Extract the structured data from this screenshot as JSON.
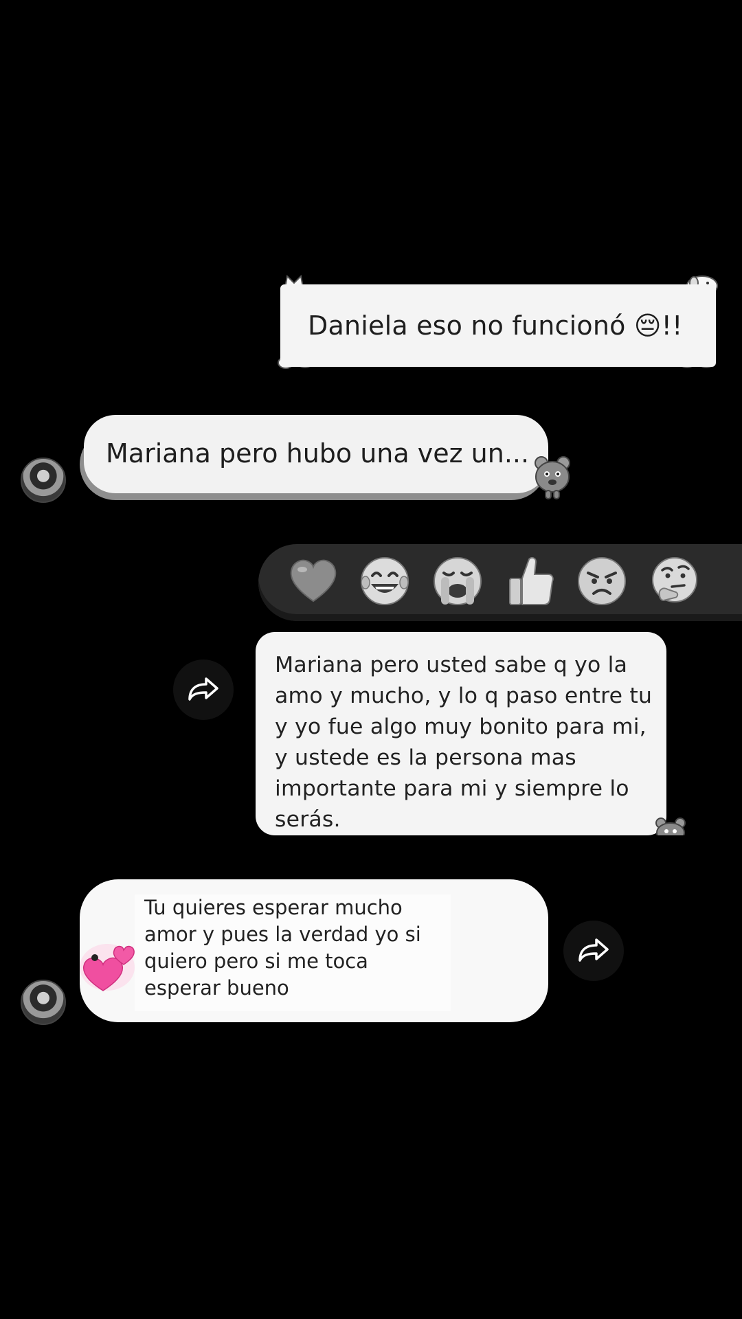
{
  "conversation": {
    "messages": [
      {
        "sender": "me",
        "text": "Daniela eso no funcionó 😔!!"
      },
      {
        "sender": "contact",
        "text": "Mariana pero hubo una vez un..."
      },
      {
        "sender": "me",
        "text": "Mariana pero usted sabe q yo la amo y mucho, y lo q paso entre tu y yo fue algo muy bonito para mi, y ustede es la persona mas importante para mi y siempre lo serás."
      },
      {
        "sender": "contact",
        "text": "Tu quieres esperar mucho amor y pues la verdad yo si quiero pero si me toca esperar bueno"
      }
    ]
  },
  "reactions": [
    "grey-heart",
    "laughing-tears",
    "crying",
    "thumbs-up",
    "angry",
    "thinking"
  ],
  "icons": {
    "share": "share-arrow-icon",
    "avatar": "contact-avatar",
    "sticker_hearts": "pink-hearts-icon"
  },
  "colors": {
    "background": "#000000",
    "bubble": "#f4f4f4",
    "reaction_bar": "#2b2b2b",
    "heart_pink": "#f04fa0"
  }
}
